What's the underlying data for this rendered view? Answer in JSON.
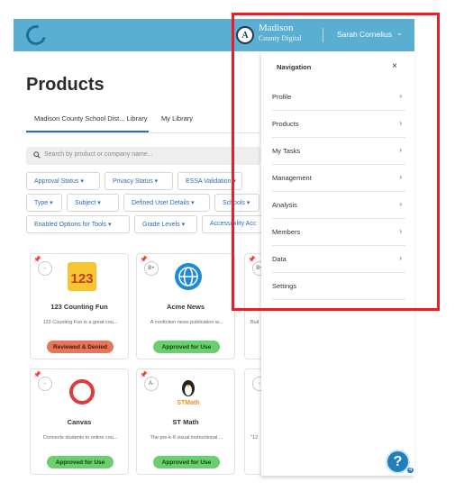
{
  "topbar": {
    "brand_logo_text": "A",
    "brand_name": "Madison",
    "brand_sub": "County Digital",
    "user_name": "Sarah Cornelius",
    "user_chevron": "⌄",
    "bg_color": "#5aaed1"
  },
  "page": {
    "title": "Products",
    "tabs": [
      {
        "label": "Madison County School Dist... Library",
        "active": true
      },
      {
        "label": "My Library",
        "active": false
      }
    ],
    "search_placeholder": "Search by product or company name...",
    "filters": [
      {
        "label": "Approval Status ▾"
      },
      {
        "label": "Privacy Status ▾"
      },
      {
        "label": "ESSA Validation ▾"
      },
      {
        "label": "Type ▾"
      },
      {
        "label": "Subject ▾"
      },
      {
        "label": "Defined User Details ▾"
      },
      {
        "label": "Schools ▾"
      },
      {
        "label": "Enabled Options for Tools ▾"
      },
      {
        "label": "Grade Levels ▾"
      },
      {
        "label": "Accessibility Acc"
      }
    ]
  },
  "cards": [
    {
      "name": "123 Counting Fun",
      "grade": "-",
      "desc": "123 Counting Fun is a great cou...",
      "status": "Reviewed & Denied",
      "status_type": "denied",
      "icon": "123-counting-logo"
    },
    {
      "name": "Acme News",
      "grade": "B+",
      "desc": "A nonfiction news publication w...",
      "status": "Approved for Use",
      "status_type": "approved",
      "icon": "globe-logo"
    },
    {
      "name": "",
      "grade": "B+",
      "desc": "Buil",
      "status": "",
      "status_type": "none",
      "icon": ""
    },
    {
      "name": "Canvas",
      "grade": "-",
      "desc": "Connects students to online cou...",
      "status": "Approved for Use",
      "status_type": "approved",
      "icon": "canvas-logo"
    },
    {
      "name": "ST Math",
      "grade": "A-",
      "desc": "The pre-k-8 visual instructional ...",
      "status": "Approved for Use",
      "status_type": "approved",
      "icon": "penguin-logo",
      "logo_text": "STMath"
    },
    {
      "name": "",
      "grade": "-",
      "desc": "\"12",
      "status": "",
      "status_type": "none",
      "icon": ""
    }
  ],
  "nav": {
    "header": "Navigation",
    "close": "×",
    "items": [
      {
        "label": "Profile",
        "chevron": "›"
      },
      {
        "label": "Products",
        "chevron": "›"
      },
      {
        "label": "My Tasks",
        "chevron": "›"
      },
      {
        "label": "Management",
        "chevron": "›"
      },
      {
        "label": "Analysis",
        "chevron": "›"
      },
      {
        "label": "Members",
        "chevron": "›"
      },
      {
        "label": "Data",
        "chevron": "›"
      },
      {
        "label": "Settings",
        "chevron": ""
      }
    ]
  },
  "help": {
    "icon": "?",
    "count": "4"
  },
  "colors": {
    "accent": "#2a6eb3",
    "highlight_outline": "#ee1c24"
  }
}
